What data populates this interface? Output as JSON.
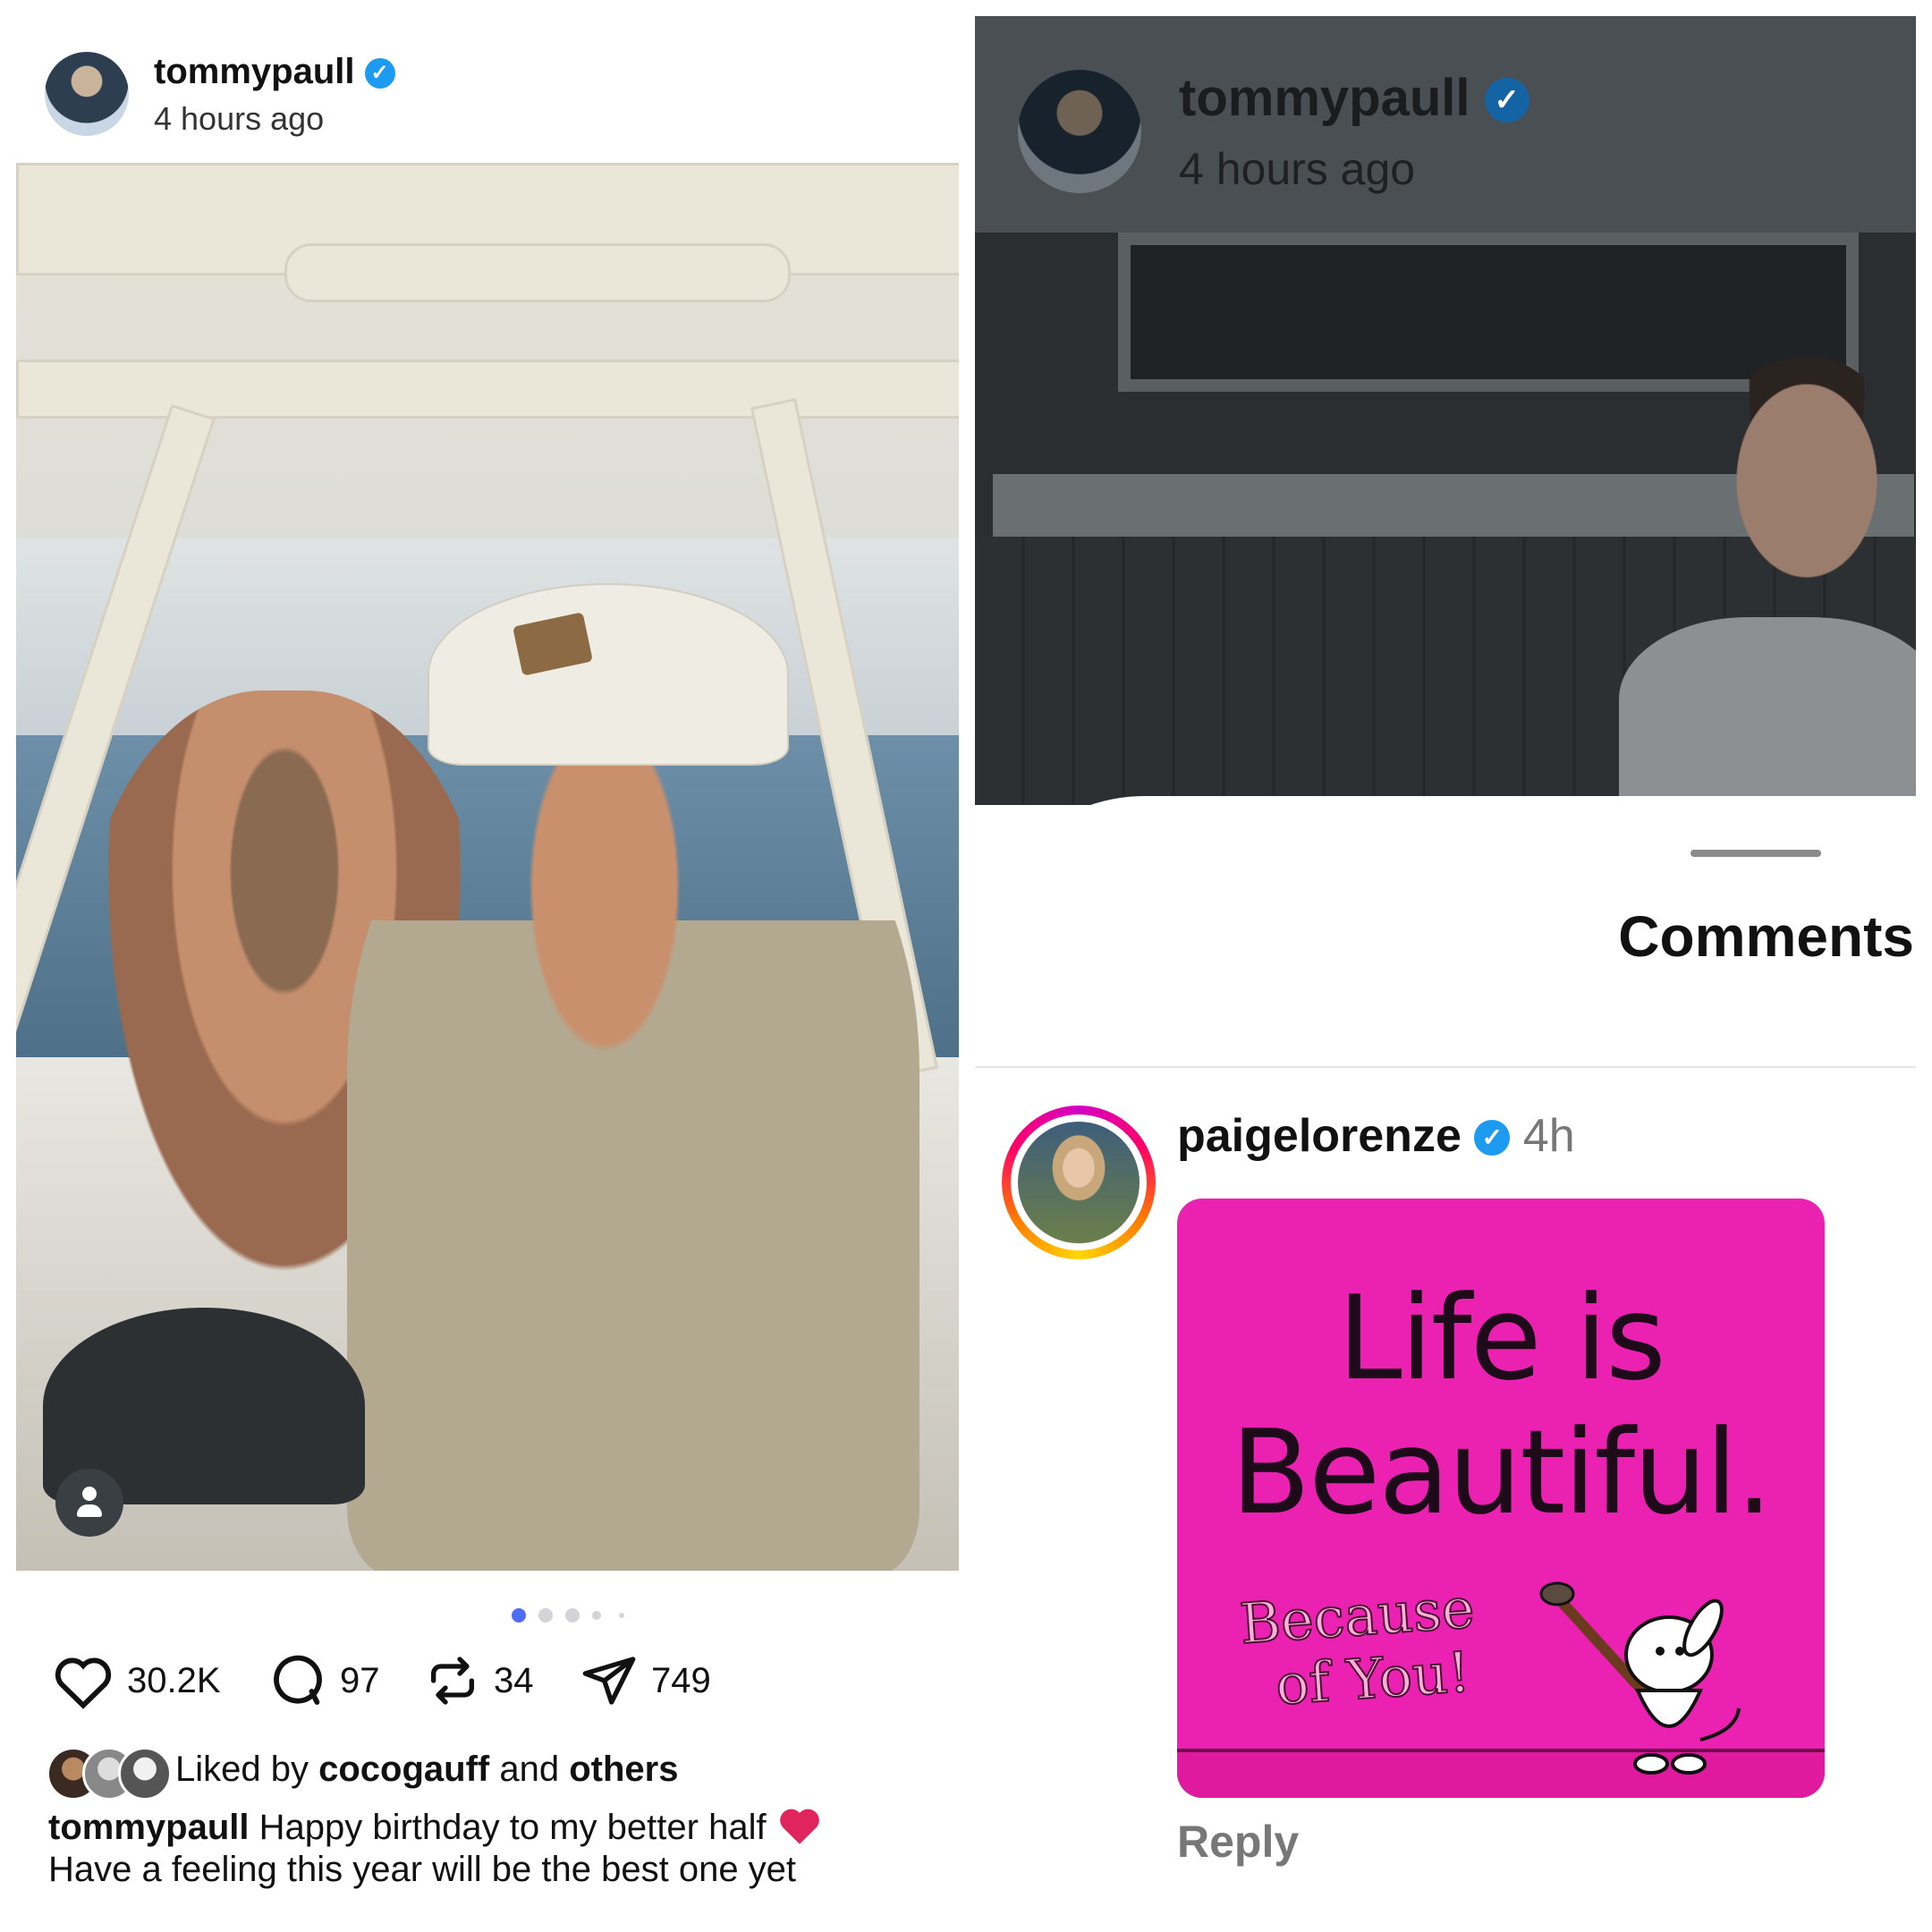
{
  "left_post": {
    "username": "tommypaull",
    "time": "4 hours ago",
    "stats": {
      "likes": "30.2K",
      "comments": "97",
      "reposts": "34",
      "shares": "749"
    },
    "liked_by_prefix": "Liked by",
    "liked_by_user": "cocogauff",
    "liked_by_and": "and",
    "liked_by_others": "others",
    "caption_user": "tommypaull",
    "caption_text": "Happy birthday to my better half",
    "caption_line2": "Have a feeling this year will be the best one yet",
    "carousel": {
      "count": 5,
      "active_index": 0
    }
  },
  "right_post": {
    "username": "tommypaull",
    "time": "4 hours ago",
    "sheet_title": "Comments",
    "comment": {
      "username": "paigelorenze",
      "time": "4h",
      "gif_text_line1": "Life is",
      "gif_text_line2": "Beautiful.",
      "gif_text_line3": "Because",
      "gif_text_line4": "of You!",
      "reply_label": "Reply"
    }
  },
  "colors": {
    "verified": "#1d9bf0",
    "carousel_active": "#4f6ef7",
    "gif_bg": "#ea21b1",
    "heart": "#e0245e"
  },
  "icons": [
    "verified-badge-icon",
    "heart-icon",
    "comment-icon",
    "repost-icon",
    "share-icon",
    "person-tag-icon",
    "red-heart-emoji-icon"
  ]
}
